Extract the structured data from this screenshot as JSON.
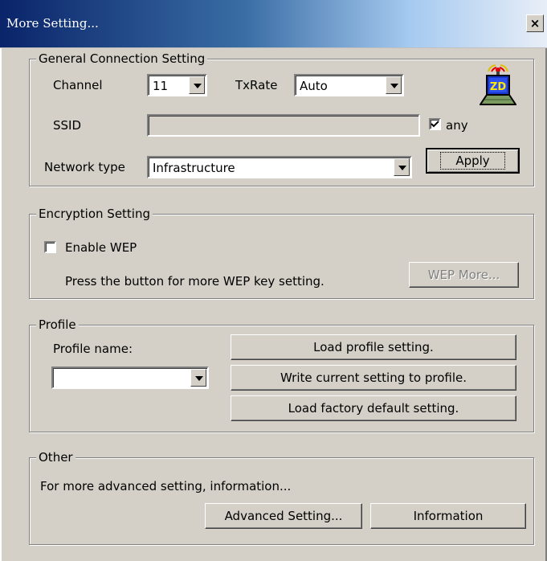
{
  "window": {
    "title": "More Setting...",
    "close_symbol": "×",
    "accent_color": "#0a246a",
    "face_color": "#d4d0c8"
  },
  "general": {
    "legend": "General Connection Setting",
    "channel_label": "Channel",
    "channel_value": "11",
    "txrate_label": "TxRate",
    "txrate_value": "Auto",
    "ssid_label": "SSID",
    "ssid_value": "",
    "any_label": "any",
    "any_checked": true,
    "network_type_label": "Network type",
    "network_type_value": "Infrastructure",
    "apply_label": "Apply",
    "logo_icon": "zd-wireless-icon",
    "logo_text": "ZD"
  },
  "encryption": {
    "legend": "Encryption Setting",
    "enable_wep_label": "Enable WEP",
    "enable_wep_checked": false,
    "hint": "Press the button for more WEP key setting.",
    "wep_more_label": "WEP More..."
  },
  "profile": {
    "legend": "Profile",
    "name_label": "Profile name:",
    "name_value": "",
    "load_label": "Load profile setting.",
    "write_label": "Write current setting to profile.",
    "factory_label": "Load factory default setting."
  },
  "other": {
    "legend": "Other",
    "text": "For more advanced setting, information...",
    "advanced_label": "Advanced Setting...",
    "information_label": "Information"
  }
}
